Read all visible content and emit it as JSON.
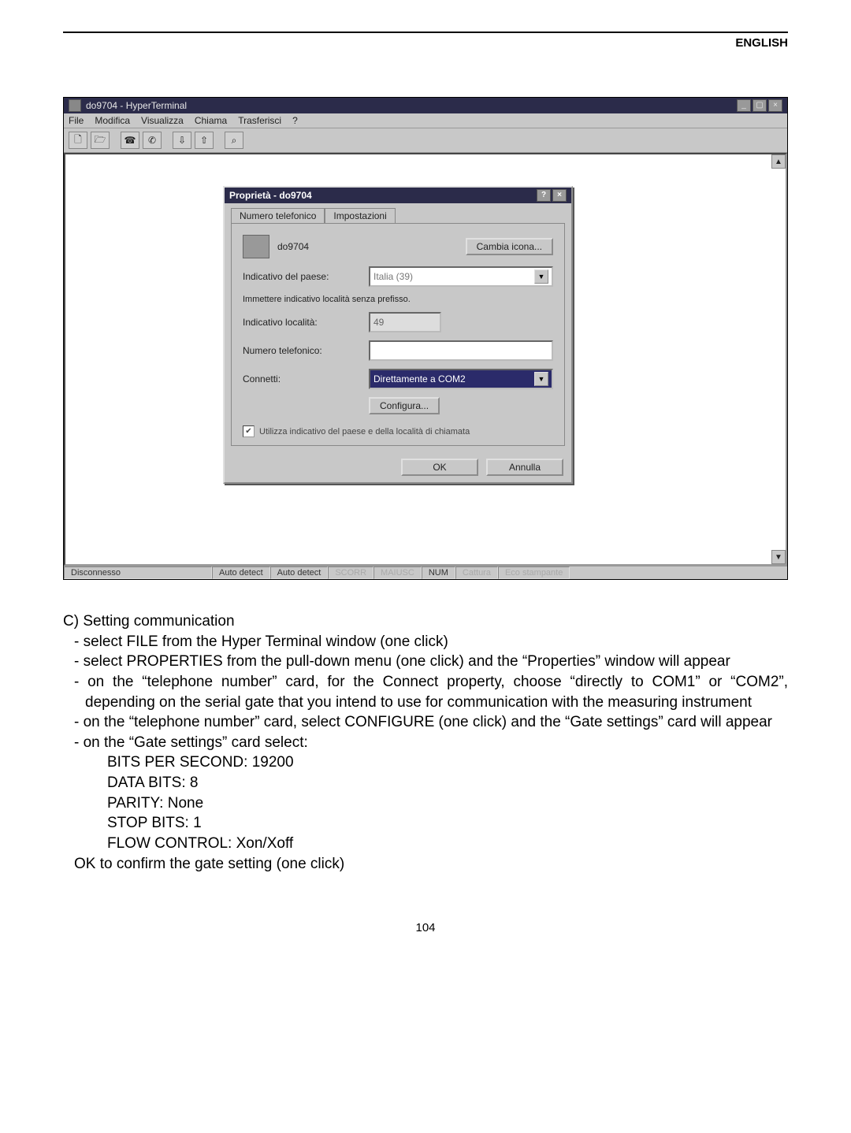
{
  "header": {
    "lang": "ENGLISH"
  },
  "ht": {
    "title": "do9704 - HyperTerminal",
    "menu": [
      "File",
      "Modifica",
      "Visualizza",
      "Chiama",
      "Trasferisci",
      "?"
    ],
    "status": {
      "conn": "Disconnesso",
      "c2": "Auto detect",
      "c3": "Auto detect",
      "c4": "SCORR",
      "c5": "MAIUSC",
      "c6": "NUM",
      "c7": "Cattura",
      "c8": "Eco stampante"
    }
  },
  "prop": {
    "title": "Proprietà - do9704",
    "tab1": "Numero telefonico",
    "tab2": "Impostazioni",
    "name": "do9704",
    "change_icon": "Cambia icona...",
    "country_label": "Indicativo del paese:",
    "country_value": "Italia (39)",
    "country_hint": "Immettere indicativo località senza prefisso.",
    "area_label": "Indicativo località:",
    "area_value": "49",
    "phone_label": "Numero telefonico:",
    "connect_label": "Connetti:",
    "connect_value": "Direttamente a COM2",
    "configure": "Configura...",
    "use_check": "Utilizza indicativo del paese e della località di chiamata",
    "ok": "OK",
    "cancel": "Annulla"
  },
  "text": {
    "heading": "C) Setting communication",
    "b1": "- select FILE from the Hyper Terminal window (one click)",
    "b2": "- select PROPERTIES from the pull-down menu (one click) and the “Properties” window will appear",
    "b3": "- on the “telephone number” card, for the Connect property, choose “directly to COM1” or “COM2”, depending on the serial gate that you intend to use for communication with the measuring instrument",
    "b4": "- on the “telephone number” card, select CONFIGURE (one click) and the “Gate settings” card will appear",
    "b5": "- on the “Gate settings” card select:",
    "s1": "BITS PER SECOND: 19200",
    "s2": "DATA BITS: 8",
    "s3": "PARITY: None",
    "s4": "STOP BITS: 1",
    "s5": "FLOW CONTROL: Xon/Xoff",
    "b6": "OK to confirm the gate setting (one click)"
  },
  "page_number": "104"
}
